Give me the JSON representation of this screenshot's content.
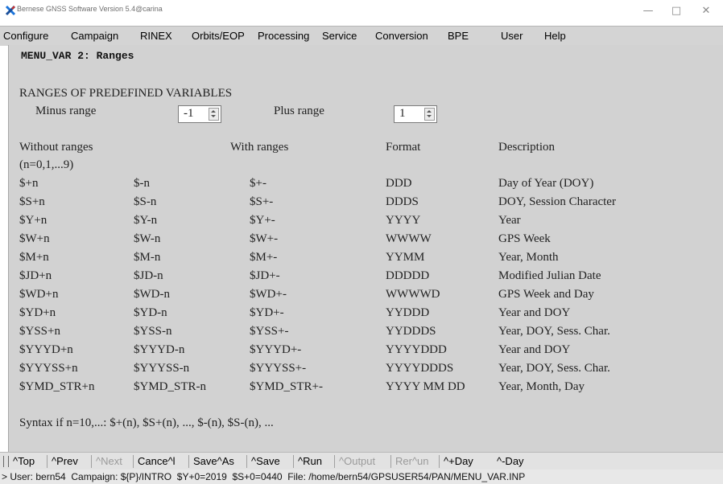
{
  "window": {
    "title": "Bernese GNSS Software Version 5.4@carina",
    "app_icon": "x-logo-icon",
    "controls": [
      "minimize-icon",
      "maximize-icon",
      "close-icon"
    ]
  },
  "menubar": {
    "items": [
      "Configure",
      "Campaign",
      "RINEX",
      "Orbits/EOP",
      "Processing",
      "Service",
      "Conversion",
      "BPE",
      "User",
      "Help"
    ]
  },
  "panel": {
    "title": "MENU_VAR 2: Ranges",
    "section_title": "RANGES OF PREDEFINED VARIABLES",
    "minus_label": "Minus range",
    "minus_value": "-1",
    "plus_label": "Plus range",
    "plus_value": "1",
    "headers": {
      "without": "Without ranges",
      "without_sub": "(n=0,1,...9)",
      "with": "With ranges",
      "format": "Format",
      "description": "Description"
    },
    "rows": [
      [
        "$+n",
        "$-n",
        "$+-",
        "DDD",
        "Day of Year (DOY)"
      ],
      [
        "$S+n",
        "$S-n",
        "$S+-",
        "DDDS",
        "DOY, Session Character"
      ],
      [
        "$Y+n",
        "$Y-n",
        "$Y+-",
        "YYYY",
        "Year"
      ],
      [
        "$W+n",
        "$W-n",
        "$W+-",
        "WWWW",
        "GPS Week"
      ],
      [
        "$M+n",
        "$M-n",
        "$M+-",
        "YYMM",
        "Year, Month"
      ],
      [
        "$JD+n",
        "$JD-n",
        "$JD+-",
        "DDDDD",
        "Modified Julian Date"
      ],
      [
        "$WD+n",
        "$WD-n",
        "$WD+-",
        "WWWWD",
        "GPS Week and Day"
      ],
      [
        "$YD+n",
        "$YD-n",
        "$YD+-",
        "YYDDD",
        "Year and DOY"
      ],
      [
        "$YSS+n",
        "$YSS-n",
        "$YSS+-",
        "YYDDDS",
        "Year, DOY, Sess. Char."
      ],
      [
        "$YYYD+n",
        "$YYYD-n",
        "$YYYD+-",
        "YYYYDDD",
        "Year and DOY"
      ],
      [
        "$YYYSS+n",
        "$YYYSS-n",
        "$YYYSS+-",
        "YYYYDDDS",
        "Year, DOY, Sess. Char."
      ],
      [
        "$YMD_STR+n",
        "$YMD_STR-n",
        "$YMD_STR+-",
        "YYYY MM DD",
        "Year, Month, Day"
      ]
    ],
    "syntax": "Syntax if n=10,...: $+(n), $S+(n), ..., $-(n), $S-(n), ..."
  },
  "toolbar": {
    "items": [
      {
        "label": "^Top",
        "enabled": true
      },
      {
        "label": "^Prev",
        "enabled": true
      },
      {
        "label": "^Next",
        "enabled": false
      },
      {
        "label": "Cance^l",
        "enabled": true
      },
      {
        "label": "Save^As",
        "enabled": true
      },
      {
        "label": "^Save",
        "enabled": true
      },
      {
        "label": "^Run",
        "enabled": true
      },
      {
        "label": "^Output",
        "enabled": false
      },
      {
        "label": "Rer^un",
        "enabled": false
      },
      {
        "label": "^+Day",
        "enabled": true
      },
      {
        "label": "^-Day",
        "enabled": true
      }
    ]
  },
  "status": "> User: bern54  Campaign: ${P}/INTRO  $Y+0=2019  $S+0=0440  File: /home/bern54/GPSUSER54/PAN/MENU_VAR.INP",
  "colors": {
    "panel_bg": "#d2d2d2",
    "menubar_bg": "#d4d4d4",
    "disabled_text": "#9a9a9a",
    "logo_blue": "#1a73d9",
    "logo_red": "#d93025"
  }
}
